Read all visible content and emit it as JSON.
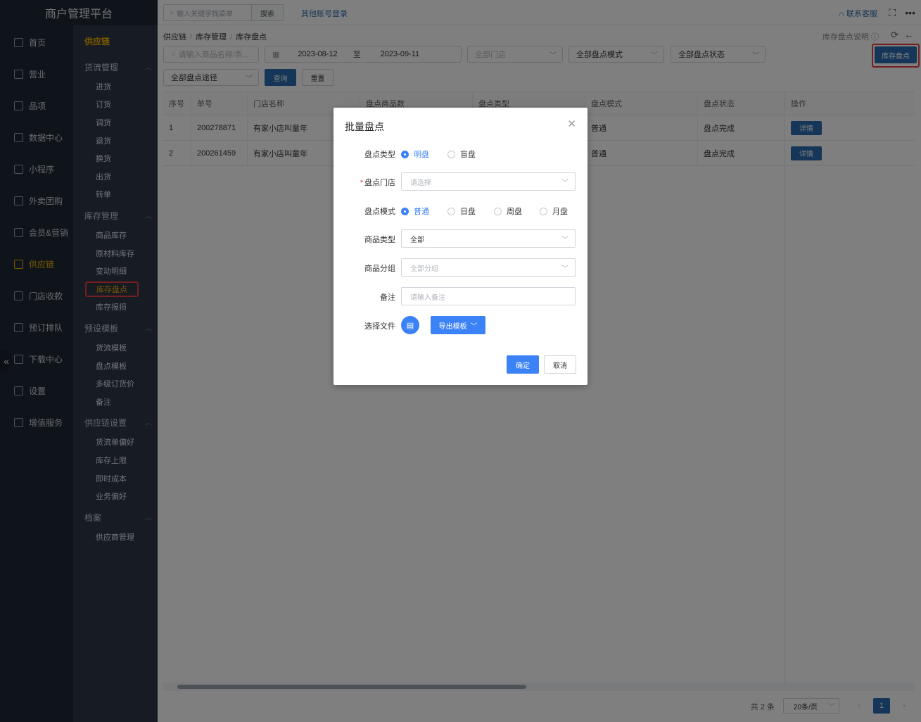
{
  "app": {
    "title": "商户管理平台"
  },
  "topbar": {
    "search_placeholder": "输入关键字找菜单",
    "search_button": "搜索",
    "other_login": "其他账号登录",
    "contact": "联系客服",
    "icons": [
      "headset-icon",
      "fullscreen-icon",
      "more-icon"
    ]
  },
  "nav1": [
    {
      "label": "首页",
      "icon": "home-icon"
    },
    {
      "label": "营业",
      "icon": "calendar-icon"
    },
    {
      "label": "品项",
      "icon": "bag-icon"
    },
    {
      "label": "数据中心",
      "icon": "share-icon"
    },
    {
      "label": "小程序",
      "icon": "phone-icon"
    },
    {
      "label": "外卖团购",
      "icon": "bike-icon"
    },
    {
      "label": "会员&营销",
      "icon": "user-icon"
    },
    {
      "label": "供应链",
      "icon": "truck-icon",
      "active": true
    },
    {
      "label": "门店收款",
      "icon": "coin-icon"
    },
    {
      "label": "预订排队",
      "icon": "clock-icon"
    },
    {
      "label": "下载中心",
      "icon": "download-icon"
    },
    {
      "label": "设置",
      "icon": "gear-icon"
    },
    {
      "label": "增值服务",
      "icon": "alarm-icon"
    }
  ],
  "nav2": {
    "title": "供应链",
    "groups": [
      {
        "label": "货流管理",
        "items": [
          "进货",
          "订货",
          "调货",
          "退货",
          "换货",
          "出货",
          "转单"
        ]
      },
      {
        "label": "库存管理",
        "items": [
          "商品库存",
          "原材料库存",
          "变动明细",
          "库存盘点",
          "库存报损"
        ]
      },
      {
        "label": "预设模板",
        "items": [
          "货流模板",
          "盘点模板",
          "多级订货价",
          "备注"
        ]
      },
      {
        "label": "供应链设置",
        "items": [
          "货流单偏好",
          "库存上限",
          "即时成本",
          "业务偏好"
        ]
      },
      {
        "label": "档案",
        "items": [
          "供应商管理"
        ]
      }
    ],
    "active_item": "库存盘点"
  },
  "breadcrumb": [
    "供应链",
    "库存管理",
    "库存盘点"
  ],
  "header_right": {
    "help": "库存盘点说明"
  },
  "filters": {
    "product_placeholder": "请输入商品名称/条...",
    "date_start": "2023-08-12",
    "date_sep": "至",
    "date_end": "2023-09-11",
    "store": "全部门店",
    "mode": "全部盘点模式",
    "status": "全部盘点状态",
    "route": "全部盘点途径",
    "query": "查询",
    "reset": "重置",
    "stocktake_button": "库存盘点"
  },
  "table": {
    "columns": [
      "序号",
      "单号",
      "门店名称",
      "盘点商品数",
      "盘点类型",
      "盘点模式",
      "盘点状态",
      "操作"
    ],
    "rows": [
      {
        "idx": "1",
        "no": "200278871",
        "store": "有家小店叫童年",
        "count": "",
        "type": "",
        "mode": "普通",
        "status": "盘点完成",
        "action": "详情"
      },
      {
        "idx": "2",
        "no": "200261459",
        "store": "有家小店叫童年",
        "count": "",
        "type": "",
        "mode": "普通",
        "status": "盘点完成",
        "action": "详情"
      }
    ]
  },
  "pager": {
    "total": "共 2 条",
    "size": "20条/页",
    "page": "1"
  },
  "modal": {
    "title": "批量盘点",
    "type_label": "盘点类型",
    "type_options": [
      "明盘",
      "盲盘"
    ],
    "type_selected": "明盘",
    "store_label": "盘点门店",
    "store_placeholder": "请选择",
    "mode_label": "盘点模式",
    "mode_options": [
      "普通",
      "日盘",
      "周盘",
      "月盘"
    ],
    "mode_selected": "普通",
    "product_type_label": "商品类型",
    "product_type_value": "全部",
    "group_label": "商品分组",
    "group_placeholder": "全部分组",
    "remark_label": "备注",
    "remark_placeholder": "请输入备注",
    "file_label": "选择文件",
    "export_button": "导出模板",
    "ok": "确定",
    "cancel": "取消"
  },
  "colors": {
    "primary": "#2b6cb0",
    "modal_primary": "#3b82f6",
    "accent_nav": "#f5b400",
    "highlight": "#e53e3e"
  }
}
